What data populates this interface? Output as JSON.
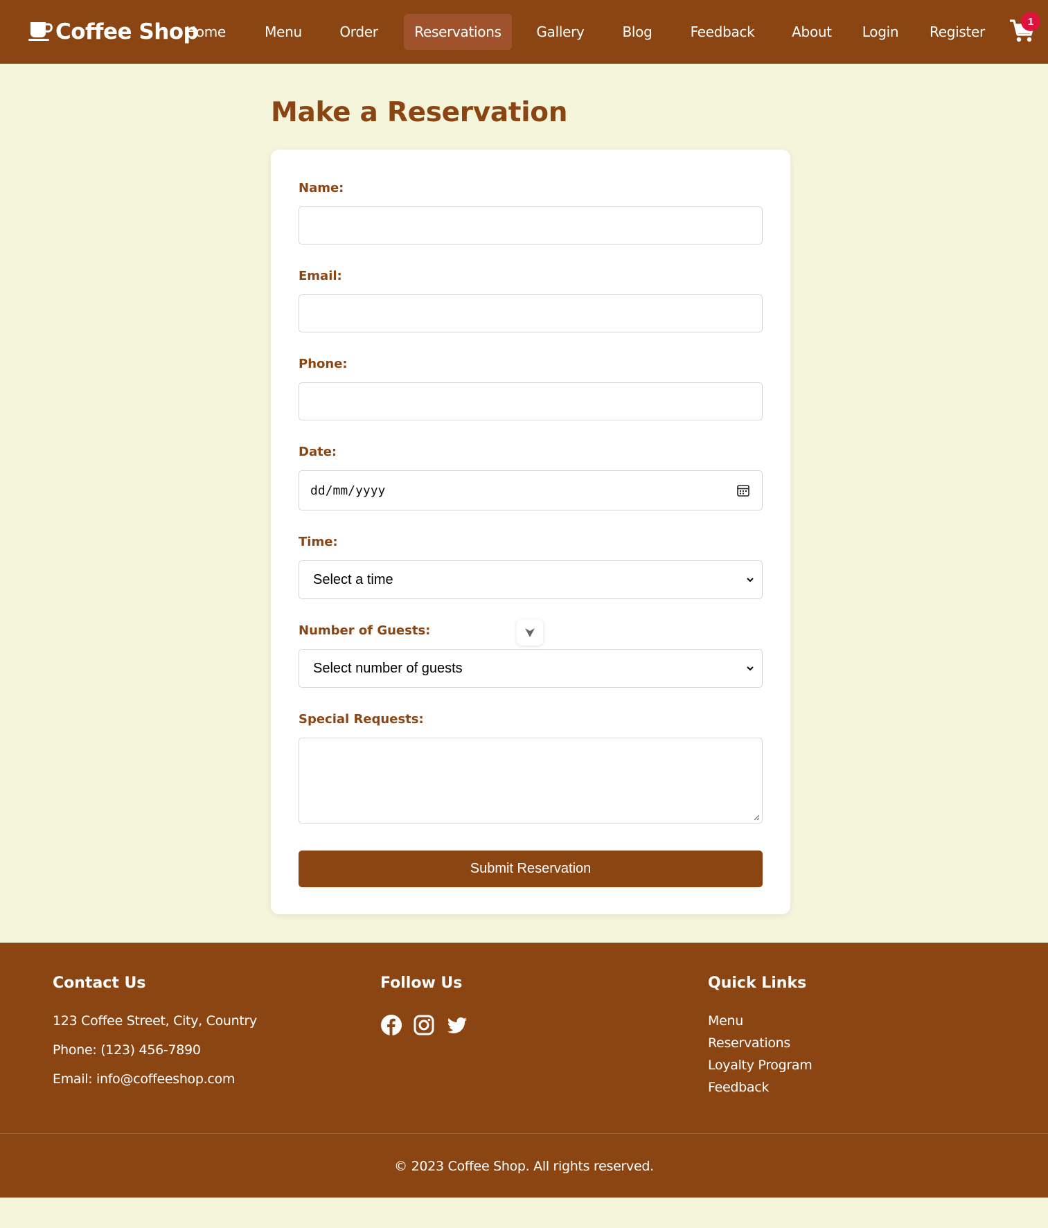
{
  "brand": {
    "name": "Coffee Shop",
    "logo_icon": "coffee-cup-icon"
  },
  "nav": {
    "items": [
      {
        "label": "Home"
      },
      {
        "label": "Menu"
      },
      {
        "label": "Order"
      },
      {
        "label": "Reservations",
        "active": true
      },
      {
        "label": "Gallery"
      },
      {
        "label": "Blog"
      },
      {
        "label": "Feedback"
      },
      {
        "label": "About"
      },
      {
        "label": "Login"
      },
      {
        "label": "Register"
      }
    ],
    "cart_icon": "shopping-cart-icon",
    "cart_count": "1"
  },
  "page": {
    "title": "Make a Reservation"
  },
  "form": {
    "name_label": "Name:",
    "name_value": "",
    "email_label": "Email:",
    "email_value": "",
    "phone_label": "Phone:",
    "phone_value": "",
    "date_label": "Date:",
    "date_placeholder": "dd/mm/yyyy",
    "time_label": "Time:",
    "time_selected": "Select a time",
    "guests_label": "Number of Guests:",
    "guests_selected": "Select number of guests",
    "requests_label": "Special Requests:",
    "requests_value": "",
    "submit_label": "Submit Reservation"
  },
  "footer": {
    "contact": {
      "heading": "Contact Us",
      "address": "123 Coffee Street, City, Country",
      "phone": "Phone: (123) 456-7890",
      "email": "Email: info@coffeeshop.com"
    },
    "follow": {
      "heading": "Follow Us",
      "icons": [
        "facebook-icon",
        "instagram-icon",
        "twitter-icon"
      ]
    },
    "quick_links": {
      "heading": "Quick Links",
      "links": [
        "Menu",
        "Reservations",
        "Loyalty Program",
        "Feedback"
      ]
    },
    "copyright": "© 2023 Coffee Shop. All rights reserved."
  },
  "colors": {
    "primary": "#8B4513",
    "active_nav": "#A0522D",
    "background": "#F5F5DC",
    "badge": "#DC143C"
  }
}
